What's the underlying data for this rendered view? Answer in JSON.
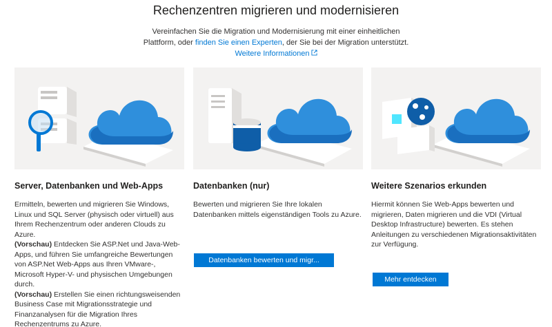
{
  "header": {
    "title": "Rechenzentren migrieren und modernisieren",
    "subtitle_part1": "Vereinfachen Sie die Migration und Modernisierung mit einer einheitlichen Plattform, oder",
    "find_expert_link": "finden Sie einen Experten",
    "subtitle_part2": ", der Sie bei der Migration unterstützt.",
    "more_info_link": "Weitere Informationen"
  },
  "cards": [
    {
      "title": "Server, Datenbanken und Web-Apps",
      "p1": "Ermitteln, bewerten und migrieren Sie Windows, Linux und SQL Server (physisch oder virtuell) aus Ihrem Rechenzentrum oder anderen Clouds zu Azure.",
      "p2_label": "(Vorschau)",
      "p2": " Entdecken Sie ASP.Net und Java-Web-Apps, und führen Sie umfangreiche Bewertungen von ASP.Net Web-Apps aus Ihren VMware-, Microsoft Hyper-V- und physischen Umgebungen durch.",
      "p3_label": "(Vorschau)",
      "p3": " Erstellen Sie einen richtungsweisenden Business Case mit Migrationsstrategie und Finanzanalysen für die Migration Ihres Rechenzentrums zu Azure."
    },
    {
      "title": "Datenbanken (nur)",
      "text": "Bewerten und migrieren Sie Ihre lokalen Datenbanken mittels eigenständigen Tools zu Azure.",
      "button": "Datenbanken bewerten und migr..."
    },
    {
      "title": "Weitere Szenarios erkunden",
      "text": "Hiermit können Sie Web-Apps bewerten und migrieren, Daten migrieren und die VDI (Virtual Desktop Infrastructure) bewerten. Es stehen Anleitungen zu verschiedenen Migrationsaktivitäten zur Verfügung.",
      "button": "Mehr entdecken"
    }
  ],
  "colors": {
    "accent": "#0078d4",
    "illustration_bg": "#f3f2f1",
    "cloud_blue": "#3a96dd"
  },
  "icons": [
    "external-link-icon",
    "cloud-icon",
    "server-icon",
    "magnifier-icon",
    "database-icon",
    "monitor-icon"
  ]
}
